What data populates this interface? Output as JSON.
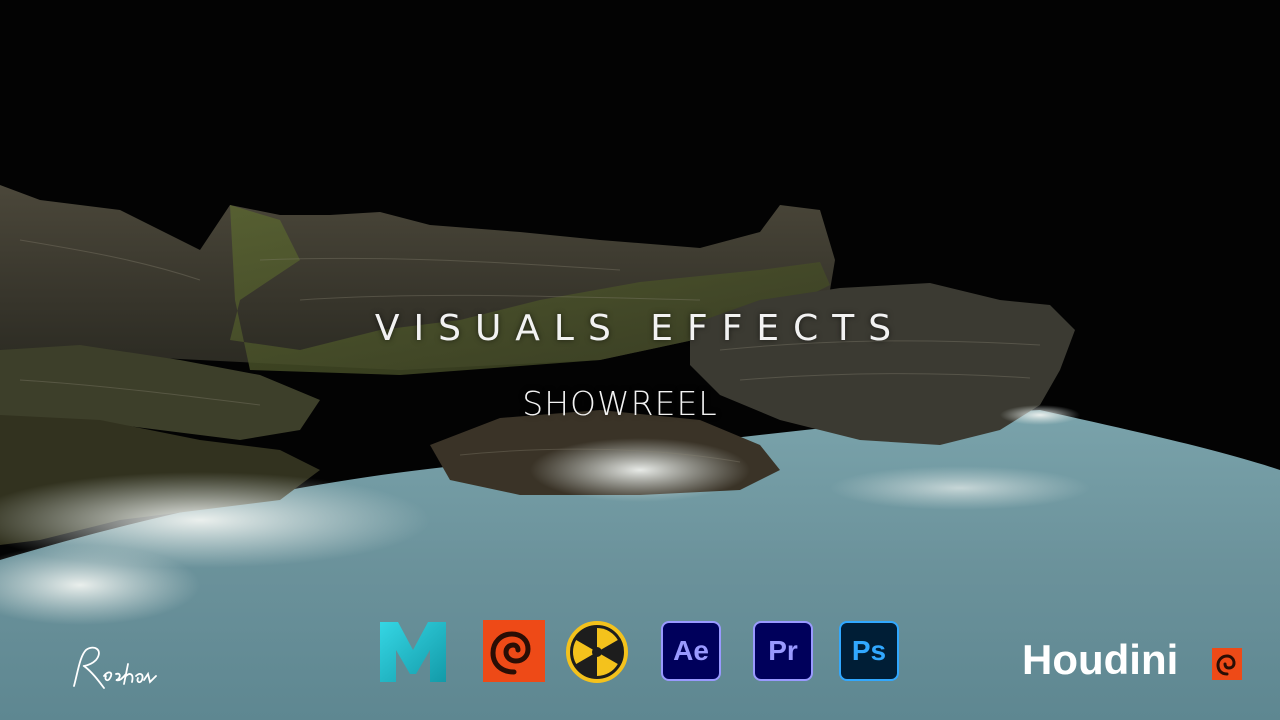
{
  "title": "VISUALS EFFECTS",
  "subtitle": "SHOWREEL",
  "signature": "Roshan",
  "brand_wordmark": "Houdini",
  "software_logos": [
    {
      "name": "maya",
      "label": "M",
      "color": "#20c6d6"
    },
    {
      "name": "houdini",
      "label": "",
      "color": "#ee4a17"
    },
    {
      "name": "nuke",
      "label": "",
      "color": "#f4c21c"
    },
    {
      "name": "after-effects",
      "label": "Ae",
      "color": "#9999ff"
    },
    {
      "name": "premiere-pro",
      "label": "Pr",
      "color": "#9999ff"
    },
    {
      "name": "photoshop",
      "label": "Ps",
      "color": "#31a8ff"
    }
  ],
  "colors": {
    "background": "#030303",
    "rock": "#3e3a2d",
    "moss": "#4d5a28",
    "water": "#6f97a0",
    "foam": "#e6ece8",
    "text": "#f2f2f2"
  }
}
